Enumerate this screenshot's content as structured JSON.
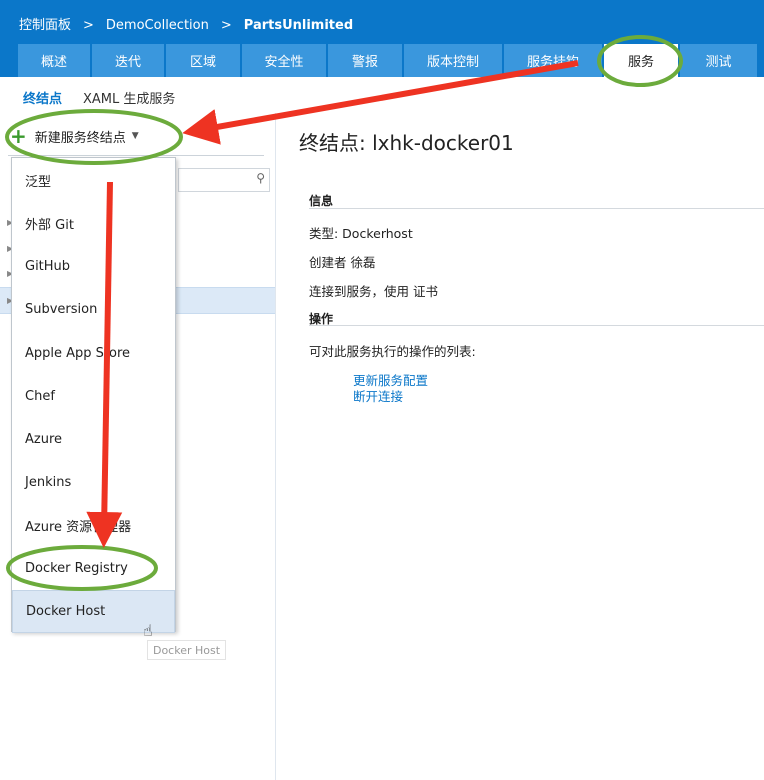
{
  "breadcrumb": {
    "root": "控制面板",
    "sep": ">",
    "collection": "DemoCollection",
    "project": "PartsUnlimited"
  },
  "tabs": [
    "概述",
    "迭代",
    "区域",
    "安全性",
    "警报",
    "版本控制",
    "服务挂钩",
    "服务",
    "测试"
  ],
  "active_tab": "服务",
  "subnav": {
    "active": "终结点",
    "other": "XAML 生成服务"
  },
  "new_endpoint_button": "新建服务终结点",
  "dropdown_items": [
    "泛型",
    "外部 Git",
    "GitHub",
    "Subversion",
    "Apple App Store",
    "Chef",
    "Azure",
    "Jenkins",
    "Azure 资源管理器",
    "Docker Registry",
    "Docker Host"
  ],
  "hovered_item": "Docker Host",
  "tooltip": "Docker Host",
  "detail": {
    "title": "终结点: lxhk-docker01",
    "info_header": "信息",
    "type": "类型: Dockerhost",
    "creator": "创建者 徐磊",
    "connect": "连接到服务，使用 证书",
    "actions_header": "操作",
    "actions_desc": "可对此服务执行的操作的列表:",
    "action_update": "更新服务配置",
    "action_disconnect": "断开连接"
  },
  "colors": {
    "accent": "#0b77c9",
    "tab_bg": "#3a97dd",
    "highlight_ring": "#6cab3c",
    "arrow": "#ee3322"
  }
}
